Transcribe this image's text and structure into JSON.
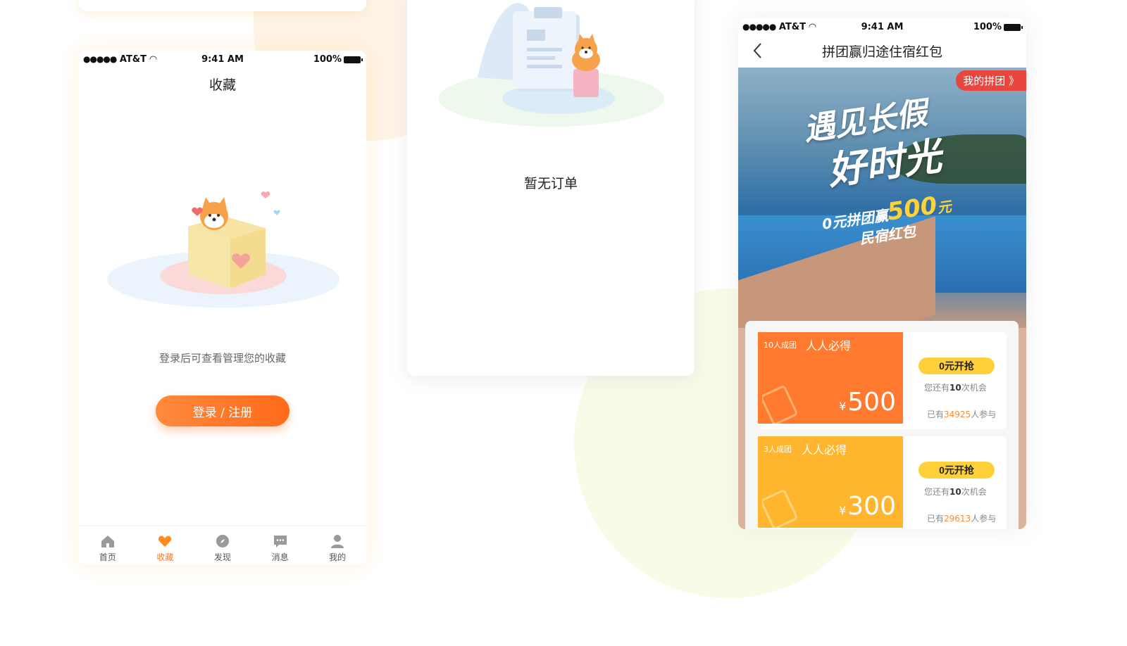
{
  "status": {
    "carrier": "AT&T",
    "time": "9:41 AM",
    "battery": "100%"
  },
  "favorites_screen": {
    "title": "收藏",
    "message": "登录后可查看管理您的收藏",
    "login_button": "登录 / 注册",
    "tabs": [
      {
        "label": "首页",
        "icon": "home-icon",
        "active": false
      },
      {
        "label": "收藏",
        "icon": "heart-icon",
        "active": true
      },
      {
        "label": "发现",
        "icon": "compass-icon",
        "active": false
      },
      {
        "label": "消息",
        "icon": "message-icon",
        "active": false
      },
      {
        "label": "我的",
        "icon": "user-icon",
        "active": false
      }
    ]
  },
  "orders_screen": {
    "empty_message": "暂无订单"
  },
  "group_screen": {
    "title": "拼团赢归途住宿红包",
    "my_group_label": "我的拼团 》",
    "banner": {
      "headline_top": "遇见长假",
      "headline_bottom": "好时光",
      "promo_line1_prefix": "0元拼团赢",
      "promo_amount": "500",
      "promo_unit": "元",
      "promo_line2": "民宿红包"
    },
    "coupons": [
      {
        "tag": "10人成团",
        "title": "人人必得",
        "currency": "¥",
        "amount": "500",
        "button": "0元开抢",
        "chance_prefix": "您还有",
        "chance_count": "10",
        "chance_suffix": "次机会",
        "joined_prefix": "已有",
        "joined_count": "34925",
        "joined_suffix": "人参与",
        "color": "#ff7a2e"
      },
      {
        "tag": "3人成团",
        "title": "人人必得",
        "currency": "¥",
        "amount": "300",
        "button": "0元开抢",
        "chance_prefix": "您还有",
        "chance_count": "10",
        "chance_suffix": "次机会",
        "joined_prefix": "已有",
        "joined_count": "29613",
        "joined_suffix": "人参与",
        "color": "#ffb52e"
      }
    ]
  }
}
